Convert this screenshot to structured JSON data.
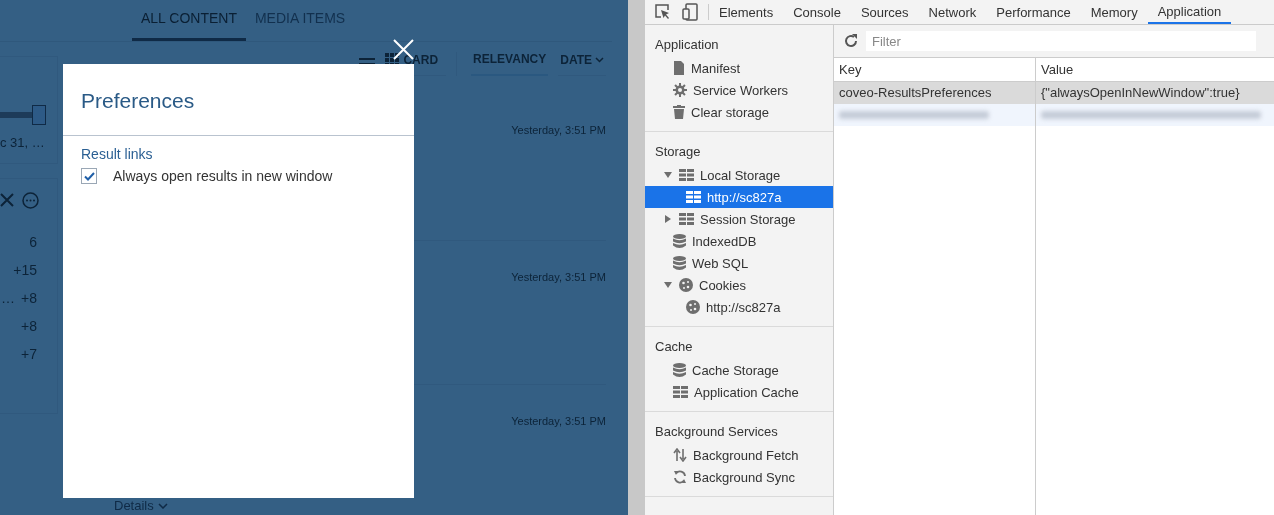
{
  "page": {
    "tabs": [
      {
        "label": "ALL CONTENT",
        "selected": true
      },
      {
        "label": "MEDIA ITEMS",
        "selected": false
      }
    ],
    "facet_slider": {
      "level": 1
    },
    "facet_date": "c 31, …",
    "facet_counts": [
      {
        "count": "6"
      },
      {
        "count": "+15"
      },
      {
        "label": "…",
        "count": "+8"
      },
      {
        "count": "+8"
      },
      {
        "count": "+7"
      }
    ],
    "layout_options": [
      {
        "label": "CARD"
      }
    ],
    "sort_options": [
      {
        "label": "RELEVANCY",
        "selected": true
      },
      {
        "label": "DATE",
        "selected": false
      }
    ],
    "results": [
      {
        "date": "Yesterday, 3:51 PM"
      },
      {
        "date": "Yesterday, 3:51 PM"
      },
      {
        "date": "Yesterday, 3:51 PM"
      }
    ],
    "details_link": "Details"
  },
  "modal": {
    "title": "Preferences",
    "section": "Result links",
    "options": [
      {
        "label": "Always open results in new window",
        "checked": true
      }
    ]
  },
  "devtools": {
    "tabs": [
      {
        "label": "Elements",
        "selected": false
      },
      {
        "label": "Console",
        "selected": false
      },
      {
        "label": "Sources",
        "selected": false
      },
      {
        "label": "Network",
        "selected": false
      },
      {
        "label": "Performance",
        "selected": false
      },
      {
        "label": "Memory",
        "selected": false
      },
      {
        "label": "Application",
        "selected": true
      }
    ],
    "sidebar": [
      {
        "title": "Application",
        "items": [
          {
            "label": "Manifest",
            "kind": "file",
            "selected": false
          },
          {
            "label": "Service Workers",
            "kind": "gear",
            "selected": false
          },
          {
            "label": "Clear storage",
            "kind": "trash",
            "selected": false
          }
        ]
      },
      {
        "title": "Storage",
        "items": [
          {
            "label": "Local Storage",
            "kind": "grid",
            "selected": false,
            "expanded": true,
            "children": [
              {
                "label": "http://sc827a",
                "kind": "grid",
                "selected": true
              }
            ]
          },
          {
            "label": "Session Storage",
            "kind": "grid",
            "selected": false,
            "expanded": false
          },
          {
            "label": "IndexedDB",
            "kind": "database",
            "selected": false
          },
          {
            "label": "Web SQL",
            "kind": "database",
            "selected": false
          },
          {
            "label": "Cookies",
            "kind": "cookie",
            "selected": false,
            "expanded": true,
            "children": [
              {
                "label": "http://sc827a",
                "kind": "cookie",
                "selected": false
              }
            ]
          }
        ]
      },
      {
        "title": "Cache",
        "items": [
          {
            "label": "Cache Storage",
            "kind": "database",
            "selected": false
          },
          {
            "label": "Application Cache",
            "kind": "grid",
            "selected": false
          }
        ]
      },
      {
        "title": "Background Services",
        "items": [
          {
            "label": "Background Fetch",
            "kind": "arrows",
            "selected": false
          },
          {
            "label": "Background Sync",
            "kind": "sync",
            "selected": false
          }
        ]
      }
    ],
    "filter": {
      "placeholder": "Filter"
    },
    "table": {
      "columns": [
        "Key",
        "Value"
      ],
      "rows": [
        {
          "kind": "entry",
          "key": "coveo-ResultsPreferences",
          "value": "{\"alwaysOpenInNewWindow\":true}",
          "selected": true
        },
        {
          "kind": "blurred",
          "selected": false
        }
      ]
    }
  }
}
